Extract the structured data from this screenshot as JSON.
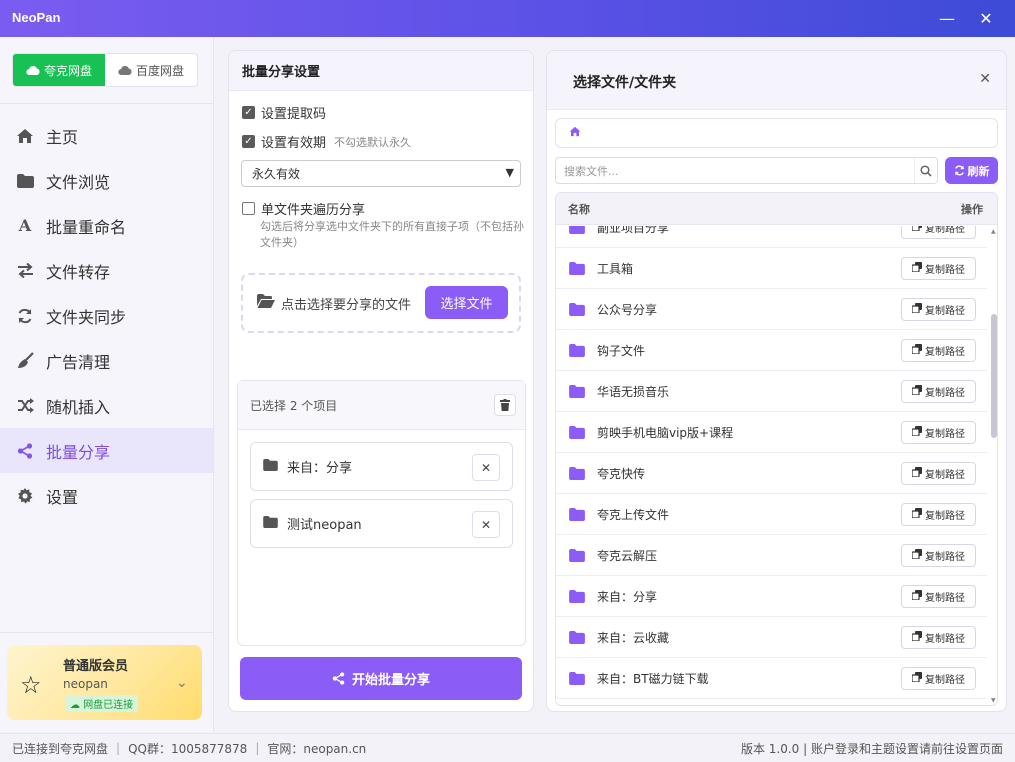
{
  "window": {
    "title": "NeoPan",
    "minimize": "—",
    "close": "✕"
  },
  "drive_tabs": [
    {
      "label": "夸克网盘",
      "active": true
    },
    {
      "label": "百度网盘",
      "active": false
    }
  ],
  "nav": [
    {
      "label": "主页",
      "icon": "home-icon"
    },
    {
      "label": "文件浏览",
      "icon": "folder-icon"
    },
    {
      "label": "批量重命名",
      "icon": "font-icon"
    },
    {
      "label": "文件转存",
      "icon": "transfer-icon"
    },
    {
      "label": "文件夹同步",
      "icon": "sync-icon"
    },
    {
      "label": "广告清理",
      "icon": "broom-icon"
    },
    {
      "label": "随机插入",
      "icon": "shuffle-icon"
    },
    {
      "label": "批量分享",
      "icon": "share-icon",
      "active": true
    },
    {
      "label": "设置",
      "icon": "gear-icon"
    }
  ],
  "member": {
    "title": "普通版会员",
    "user": "neopan",
    "badge": "网盘已连接"
  },
  "share_settings": {
    "title": "批量分享设置",
    "pwd_label": "设置提取码",
    "expiry_label": "设置有效期",
    "expiry_hint": "不勾选默认永久",
    "expiry_value": "永久有效",
    "single_label": "单文件夹遍历分享",
    "single_hint": "勾选后将分享选中文件夹下的所有直接子项（不包括孙文件夹）",
    "drop_text": "点击选择要分享的文件",
    "select_btn": "选择文件",
    "selected_text": "已选择 2 个项目",
    "selected_items": [
      "来自：分享",
      "测试neopan"
    ],
    "start_btn": "开始批量分享"
  },
  "picker": {
    "title": "选择文件/文件夹",
    "search_placeholder": "搜索文件...",
    "refresh_btn": "刷新",
    "col_name": "名称",
    "col_action": "操作",
    "copy_label": "复制路径",
    "rows": [
      "副业项目分享",
      "工具箱",
      "公众号分享",
      "钩子文件",
      "华语无损音乐",
      "剪映手机电脑vip版+课程",
      "夸克快传",
      "夸克上传文件",
      "夸克云解压",
      "来自：分享",
      "来自：云收藏",
      "来自：BT磁力链下载"
    ]
  },
  "status": {
    "connected": "已连接到夸克网盘",
    "qq": "QQ群：1005877878",
    "site": "官网：neopan.cn",
    "right": "版本 1.0.0 | 账户登录和主题设置请前往设置页面"
  },
  "colors": {
    "accent": "#8b5cf6",
    "drive_active": "#19c155",
    "folder": "#8b5cf6"
  }
}
